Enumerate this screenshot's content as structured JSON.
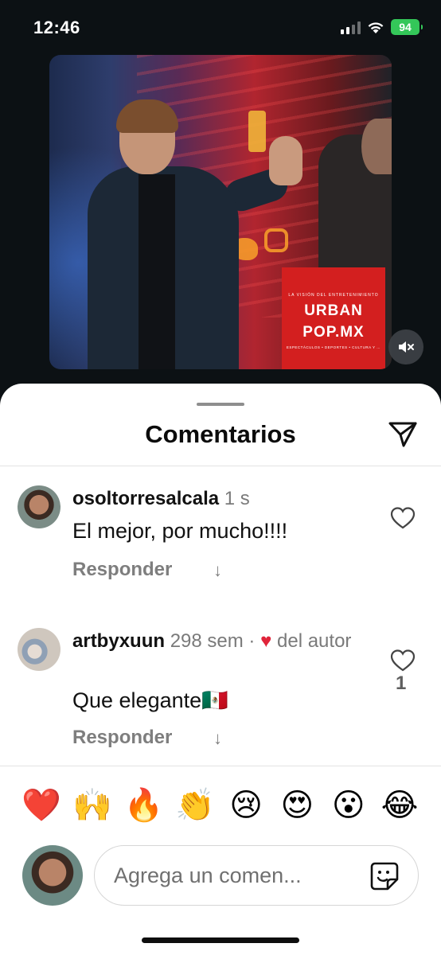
{
  "status_bar": {
    "time": "12:46",
    "battery": "94",
    "wifi_icon": "wifi-icon",
    "signal_icon": "signal-icon"
  },
  "media": {
    "brand_top": "LA VISIÓN DEL ENTRETENIMIENTO",
    "brand_line1": "URBAN",
    "brand_line2": "POP.MX",
    "brand_sub": "ESPECTÁCULOS • DEPORTES • CULTURA Y …",
    "mute_icon": "speaker-muted-icon"
  },
  "sheet": {
    "title": "Comentarios",
    "share_icon": "paper-plane-icon"
  },
  "comments": [
    {
      "user": "osoltorresalcala",
      "time": "1 s",
      "text": "El mejor, por mucho!!!!",
      "reply": "Responder",
      "reply_arrow": "↓",
      "like_count": ""
    },
    {
      "user": "artbyxuun",
      "time": "298 sem",
      "dot": "·",
      "liked_heart": "♥",
      "author_label": "del autor",
      "text": "Que elegante🇲🇽",
      "reply": "Responder",
      "reply_arrow": "↓",
      "like_count": "1"
    }
  ],
  "emojis": [
    "❤️",
    "🙌",
    "🔥",
    "👏",
    "😢",
    "😍",
    "😮",
    "😂"
  ],
  "composer": {
    "placeholder": "Agrega un comen...",
    "sticker_icon": "sticker-icon"
  },
  "colors": {
    "accent_heart": "#e0243a",
    "battery": "#34c759",
    "brand_red": "#d31f1f"
  }
}
